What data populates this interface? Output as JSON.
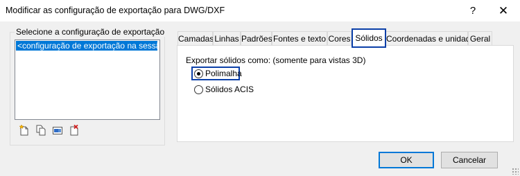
{
  "window": {
    "title": "Modificar as configuração de exportação para DWG/DXF",
    "help_glyph": "?",
    "close_glyph": "✕"
  },
  "left_panel": {
    "group_label": "Selecione a configuração de exportação",
    "list_items": [
      "<configuração de exportação na sessão>"
    ],
    "toolbar_icons": [
      "new-setup-icon",
      "duplicate-setup-icon",
      "rename-setup-icon",
      "delete-setup-icon"
    ]
  },
  "tabs": [
    {
      "label": "Camadas"
    },
    {
      "label": "Linhas"
    },
    {
      "label": "Padrões"
    },
    {
      "label": "Fontes e texto"
    },
    {
      "label": "Cores"
    },
    {
      "label": "Sólidos",
      "active": true
    },
    {
      "label": "Coordenadas e unidades"
    },
    {
      "label": "Geral"
    }
  ],
  "solids_tab": {
    "export_label": "Exportar sólidos como: (somente para vistas 3D)",
    "options": [
      {
        "label": "Polimalha",
        "checked": true
      },
      {
        "label": "Sólidos ACIS",
        "checked": false
      }
    ]
  },
  "buttons": {
    "ok": "OK",
    "cancel": "Cancelar"
  },
  "colors": {
    "selection": "#0078d7",
    "focus_outline": "#0b3fa8"
  }
}
